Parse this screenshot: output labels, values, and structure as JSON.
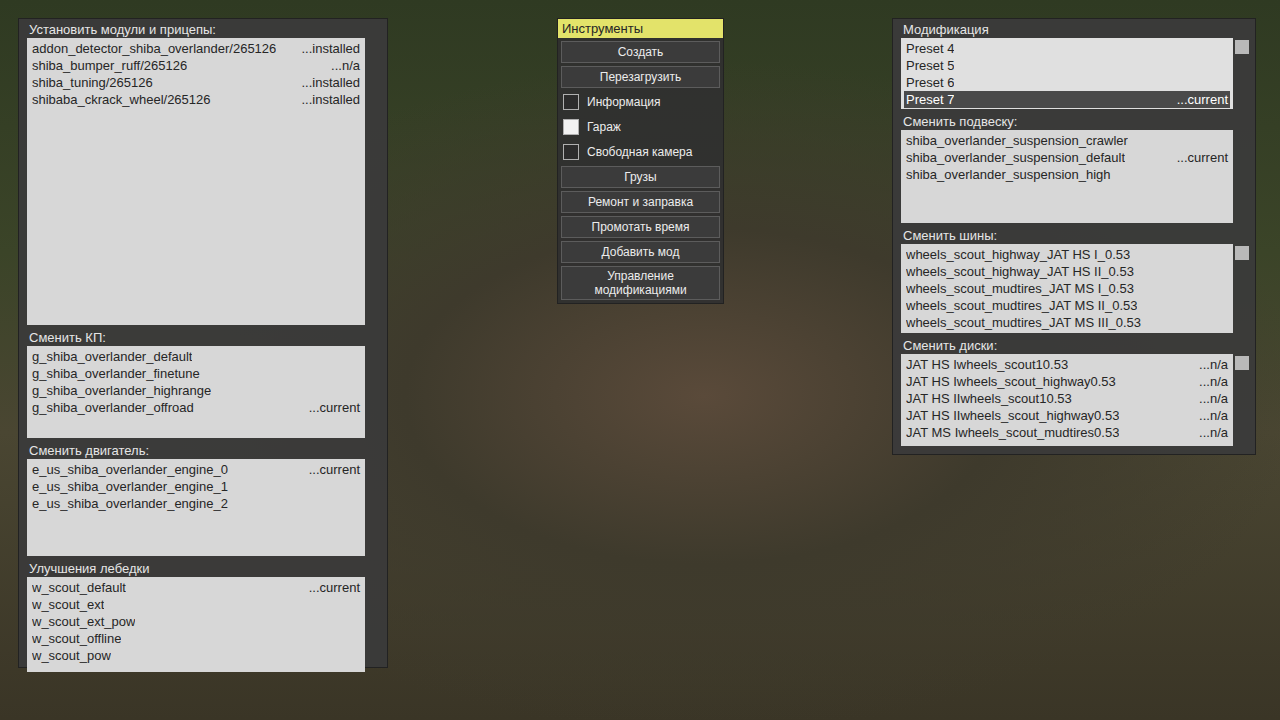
{
  "left_panel": {
    "sections": [
      {
        "title": "Установить модули и прицепы:",
        "scrollbar": false,
        "items": [
          {
            "label": "addon_detector_shiba_overlander/265126",
            "status": "...installed",
            "selected": false
          },
          {
            "label": "shiba_bumper_ruff/265126",
            "status": "...n/a",
            "selected": false
          },
          {
            "label": "shiba_tuning/265126",
            "status": "...installed",
            "selected": false
          },
          {
            "label": "shibaba_ckrack_wheel/265126",
            "status": "...installed",
            "selected": false
          }
        ]
      },
      {
        "title": "Сменить КП:",
        "scrollbar": false,
        "items": [
          {
            "label": "g_shiba_overlander_default",
            "status": "",
            "selected": false
          },
          {
            "label": "g_shiba_overlander_finetune",
            "status": "",
            "selected": false
          },
          {
            "label": "g_shiba_overlander_highrange",
            "status": "",
            "selected": false
          },
          {
            "label": "g_shiba_overlander_offroad",
            "status": "...current",
            "selected": false
          }
        ]
      },
      {
        "title": "Сменить двигатель:",
        "scrollbar": false,
        "items": [
          {
            "label": "e_us_shiba_overlander_engine_0",
            "status": "...current",
            "selected": false
          },
          {
            "label": "e_us_shiba_overlander_engine_1",
            "status": "",
            "selected": false
          },
          {
            "label": "e_us_shiba_overlander_engine_2",
            "status": "",
            "selected": false
          }
        ]
      },
      {
        "title": "Улучшения лебедки",
        "scrollbar": false,
        "items": [
          {
            "label": "w_scout_default",
            "status": "...current",
            "selected": false
          },
          {
            "label": "w_scout_ext",
            "status": "",
            "selected": false
          },
          {
            "label": "w_scout_ext_pow",
            "status": "",
            "selected": false
          },
          {
            "label": "w_scout_offline",
            "status": "",
            "selected": false
          },
          {
            "label": "w_scout_pow",
            "status": "",
            "selected": false
          }
        ]
      }
    ]
  },
  "tools": {
    "title": "Инструменты",
    "items": [
      {
        "kind": "button",
        "label": "Создать"
      },
      {
        "kind": "button",
        "label": "Перезагрузить"
      },
      {
        "kind": "checkbox",
        "label": "Информация",
        "checked": false
      },
      {
        "kind": "checkbox",
        "label": "Гараж",
        "checked": true
      },
      {
        "kind": "checkbox",
        "label": "Свободная камера",
        "checked": false
      },
      {
        "kind": "button",
        "label": "Грузы"
      },
      {
        "kind": "button",
        "label": "Ремонт и заправка"
      },
      {
        "kind": "button",
        "label": "Промотать время"
      },
      {
        "kind": "button",
        "label": "Добавить мод"
      },
      {
        "kind": "button",
        "label": "Управление модификациями"
      }
    ]
  },
  "right_panel": {
    "sections": [
      {
        "title": "Модификация",
        "scrollbar": true,
        "items": [
          {
            "label": "Preset 4",
            "status": "",
            "selected": false
          },
          {
            "label": "Preset 5",
            "status": "",
            "selected": false
          },
          {
            "label": "Preset 6",
            "status": "",
            "selected": false
          },
          {
            "label": "Preset 7",
            "status": "...current",
            "selected": true
          }
        ]
      },
      {
        "title": "Сменить подвеску:",
        "scrollbar": false,
        "items": [
          {
            "label": "shiba_overlander_suspension_crawler",
            "status": "",
            "selected": false
          },
          {
            "label": "shiba_overlander_suspension_default",
            "status": "...current",
            "selected": false
          },
          {
            "label": "shiba_overlander_suspension_high",
            "status": "",
            "selected": false
          }
        ]
      },
      {
        "title": "Сменить шины:",
        "scrollbar": true,
        "items": [
          {
            "label": "wheels_scout_highway_JAT HS I_0.53",
            "status": "",
            "selected": false
          },
          {
            "label": "wheels_scout_highway_JAT HS II_0.53",
            "status": "",
            "selected": false
          },
          {
            "label": "wheels_scout_mudtires_JAT MS I_0.53",
            "status": "",
            "selected": false
          },
          {
            "label": "wheels_scout_mudtires_JAT MS II_0.53",
            "status": "",
            "selected": false
          },
          {
            "label": "wheels_scout_mudtires_JAT MS III_0.53",
            "status": "",
            "selected": false
          }
        ]
      },
      {
        "title": "Сменить диски:",
        "scrollbar": true,
        "items": [
          {
            "label": "JAT HS Iwheels_scout10.53",
            "status": "...n/a",
            "selected": false
          },
          {
            "label": "JAT HS Iwheels_scout_highway0.53",
            "status": "...n/a",
            "selected": false
          },
          {
            "label": "JAT HS IIwheels_scout10.53",
            "status": "...n/a",
            "selected": false
          },
          {
            "label": "JAT HS IIwheels_scout_highway0.53",
            "status": "...n/a",
            "selected": false
          },
          {
            "label": "JAT MS Iwheels_scout_mudtires0.53",
            "status": "...n/a",
            "selected": false
          }
        ]
      }
    ]
  }
}
